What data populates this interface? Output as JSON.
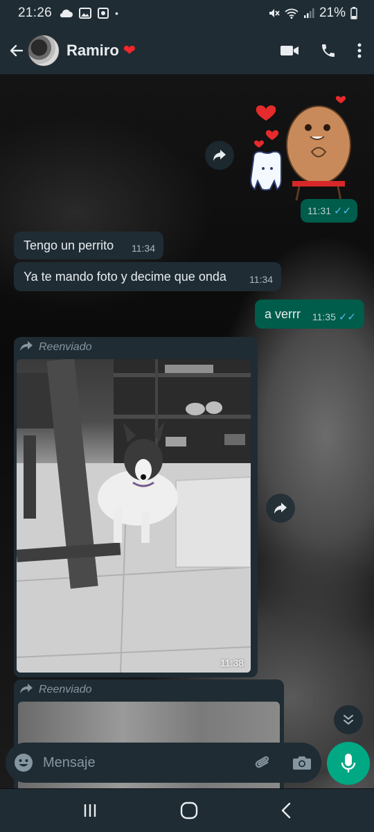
{
  "status_bar": {
    "time": "21:26",
    "dot": "•",
    "battery_text": "21%",
    "left_icons": [
      "cloud-icon",
      "gallery-icon",
      "app-icon"
    ],
    "right_icons": [
      "mute-icon",
      "wifi-icon",
      "signal-icon",
      "battery-icon"
    ]
  },
  "header": {
    "contact_name": "Ramiro",
    "heart": "❤",
    "icons": [
      "back-arrow-icon",
      "avatar",
      "video-call-icon",
      "phone-call-icon",
      "more-options-icon"
    ]
  },
  "messages": [
    {
      "type": "sticker",
      "direction": "outgoing",
      "time": "11:31",
      "ticks": "✓✓"
    },
    {
      "type": "text",
      "direction": "incoming",
      "text": "Tengo un perrito",
      "time": "11:34"
    },
    {
      "type": "text",
      "direction": "incoming",
      "text": "Ya te mando foto y decime que onda",
      "time": "11:34"
    },
    {
      "type": "text",
      "direction": "outgoing",
      "text": "a verrr",
      "time": "11:35",
      "ticks": "✓✓"
    },
    {
      "type": "photo",
      "direction": "incoming",
      "forwarded_label": "Reenviado",
      "time": "11:38"
    },
    {
      "type": "photo",
      "direction": "incoming",
      "forwarded_label": "Reenviado"
    }
  ],
  "composer": {
    "placeholder": "Mensaje",
    "icons": [
      "emoji-icon",
      "attach-icon",
      "camera-icon",
      "mic-icon"
    ]
  },
  "nav_bar": {
    "icons": [
      "recent-apps-icon",
      "home-icon",
      "back-icon"
    ]
  },
  "colors": {
    "header_bg": "#1f2c34",
    "incoming_bubble": "#1f2c34",
    "outgoing_bubble": "#005c4b",
    "accent": "#00a884",
    "read_ticks": "#53bdeb"
  }
}
